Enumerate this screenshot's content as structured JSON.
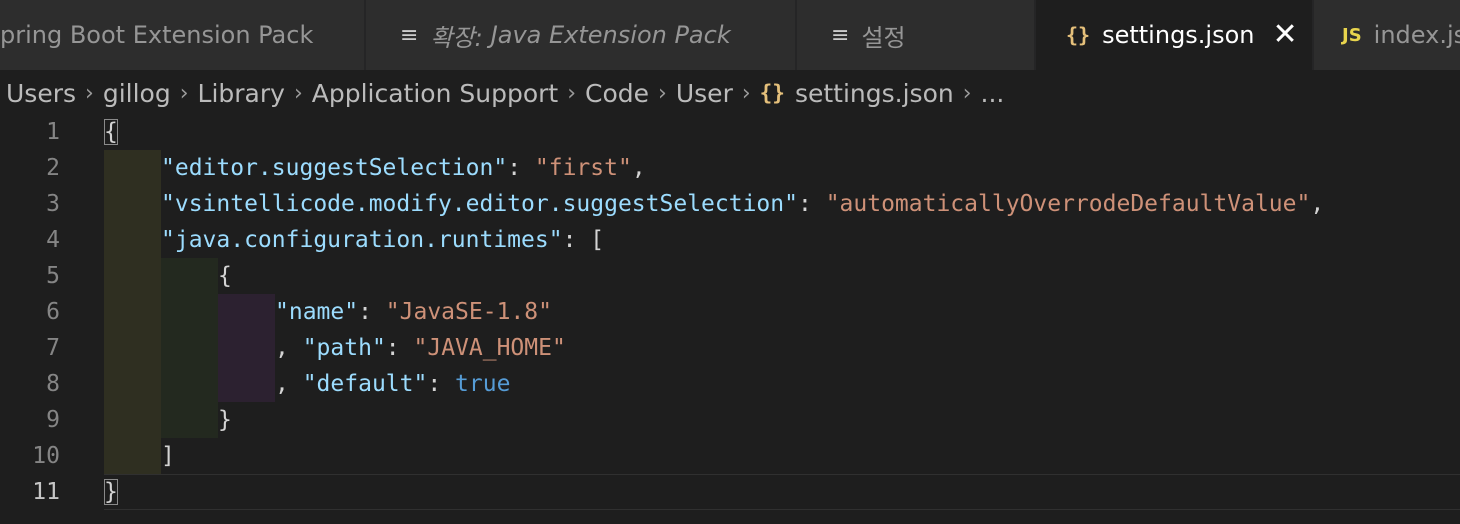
{
  "tabs": [
    {
      "label": "pring Boot Extension Pack",
      "icon": "none",
      "active": false
    },
    {
      "prefix": "확장:",
      "label": "Java Extension Pack",
      "icon": "lines-icon",
      "active": false
    },
    {
      "label": "설정",
      "icon": "lines-icon",
      "active": false
    },
    {
      "label": "settings.json",
      "icon": "braces-icon",
      "icon_glyph": "{}",
      "active": true,
      "close_glyph": "✕"
    },
    {
      "label": "index.js",
      "icon": "js-icon",
      "icon_glyph": "JS",
      "active": false
    }
  ],
  "breadcrumb": {
    "items": [
      "Users",
      "gillog",
      "Library",
      "Application Support",
      "Code",
      "User",
      "settings.json",
      "..."
    ],
    "file_icon_glyph": "{}",
    "separator": "›"
  },
  "editor": {
    "line_numbers": [
      "1",
      "2",
      "3",
      "4",
      "5",
      "6",
      "7",
      "8",
      "9",
      "10",
      "11"
    ],
    "current_line": "11",
    "lines": [
      {
        "tokens": [
          "{"
        ]
      },
      {
        "tokens": [
          "\"editor.suggestSelection\"",
          ": ",
          "\"first\"",
          ","
        ]
      },
      {
        "tokens": [
          "\"vsintellicode.modify.editor.suggestSelection\"",
          ": ",
          "\"automaticallyOverrodeDefaultValue\"",
          ","
        ]
      },
      {
        "tokens": [
          "\"java.configuration.runtimes\"",
          ": ["
        ]
      },
      {
        "tokens": [
          "{"
        ]
      },
      {
        "tokens": [
          "\"name\"",
          ": ",
          "\"JavaSE-1.8\""
        ]
      },
      {
        "tokens": [
          ", ",
          "\"path\"",
          ": ",
          "\"JAVA_HOME\""
        ]
      },
      {
        "tokens": [
          ", ",
          "\"default\"",
          ": ",
          "true"
        ]
      },
      {
        "tokens": [
          "}"
        ]
      },
      {
        "tokens": [
          "]"
        ]
      },
      {
        "tokens": [
          "}"
        ]
      }
    ]
  },
  "colors": {
    "key": "#9cdcfe",
    "string": "#ce9178",
    "boolean": "#569cd6",
    "braces_icon": "#e5c07b",
    "js_icon": "#e8d44d"
  }
}
